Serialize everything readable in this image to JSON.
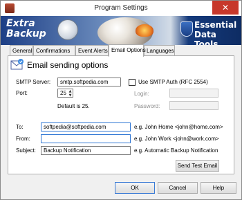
{
  "window": {
    "title": "Program Settings",
    "close_glyph": "✕"
  },
  "banner": {
    "left_logo": {
      "line1": "Extra",
      "line2": "Backup"
    },
    "right_logo": {
      "line1": "Essential",
      "line2": "Data Tools"
    }
  },
  "tabs": [
    {
      "label": "General"
    },
    {
      "label": "Confirmations"
    },
    {
      "label": "Event Alerts"
    },
    {
      "label": "Email Options",
      "active": true
    },
    {
      "label": "Languages"
    }
  ],
  "email": {
    "header": "Email sending options",
    "smtp_server_label": "SMTP Server:",
    "smtp_server_value": "smtp.softpedia.com",
    "use_auth_label": "Use SMTP Auth (RFC 2554)",
    "use_auth_checked": false,
    "port_label": "Port:",
    "port_value": "25",
    "port_default_note": "Default is 25.",
    "login_label": "Login:",
    "login_value": "",
    "password_label": "Password:",
    "password_value": "",
    "to_label": "To:",
    "to_value": "softpedia@softpedia.com",
    "to_hint": "e.g. John Home <john@home.com>",
    "from_label": "From:",
    "from_value": "",
    "from_hint": "e.g. John Work <john@work.com>",
    "subject_label": "Subject:",
    "subject_value": "Backup Notification",
    "subject_hint": "e.g. Automatic Backup Notification",
    "send_test_label": "Send Test Email"
  },
  "footer": {
    "ok_label": "OK",
    "cancel_label": "Cancel",
    "help_label": "Help"
  },
  "icons": {
    "app": "app-icon",
    "close": "close-icon",
    "email_header": "envelope-icon",
    "spin_up": "chevron-up-icon",
    "spin_down": "chevron-down-icon"
  },
  "colors": {
    "accent": "#2f76d4",
    "close": "#c7382b",
    "banner_dark": "#153a7c"
  }
}
